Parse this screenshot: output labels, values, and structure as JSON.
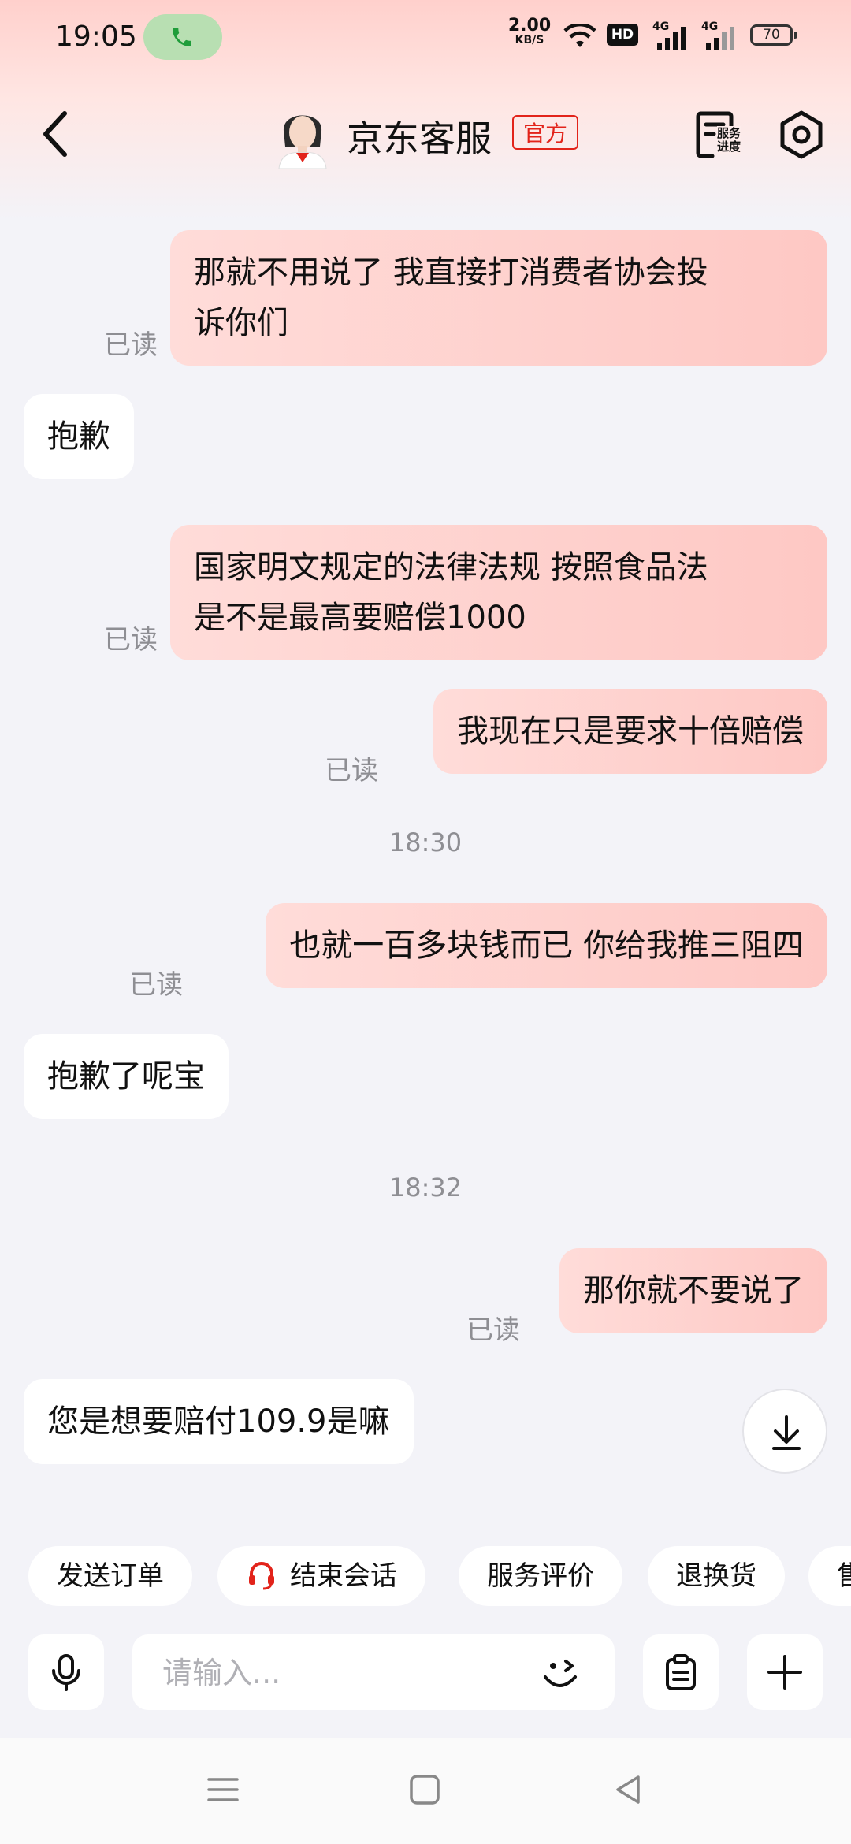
{
  "status_bar": {
    "time": "19:05",
    "net_speed_value": "2.00",
    "net_speed_unit": "KB/S",
    "hd_label": "HD",
    "signal_1": "4G",
    "signal_2": "4G",
    "battery": "70",
    "call_color": "#b8dfb2"
  },
  "header": {
    "title": "京东客服",
    "badge": "官方",
    "progress_label_line1": "服务",
    "progress_label_line2": "进度",
    "accent_color": "#e2231a"
  },
  "messages": [
    {
      "side": "out",
      "text_line1": "那就不用说了  我直接打消费者协会投",
      "text_line2": "诉你们",
      "status": "已读"
    },
    {
      "side": "in",
      "text": "抱歉"
    },
    {
      "side": "out",
      "text_line1": "国家明文规定的法律法规 按照食品法",
      "text_line2": "是不是最高要赔偿1000",
      "status": "已读"
    },
    {
      "side": "out",
      "text": "我现在只是要求十倍赔偿",
      "status": "已读"
    },
    {
      "side": "time",
      "text": "18:30"
    },
    {
      "side": "out",
      "text": "也就一百多块钱而已  你给我推三阻四",
      "status": "已读"
    },
    {
      "side": "in",
      "text": "抱歉了呢宝"
    },
    {
      "side": "time",
      "text": "18:32"
    },
    {
      "side": "out",
      "text": "那你就不要说了",
      "status": "已读"
    },
    {
      "side": "in",
      "text": "您是想要赔付109.9是嘛"
    }
  ],
  "quick_actions": [
    "发送订单",
    "结束会话",
    "服务评价",
    "退换货",
    "售"
  ],
  "input": {
    "placeholder": "请输入..."
  },
  "colors": {
    "bubble_out": "#fec8c4",
    "bubble_in": "#ffffff",
    "background": "#f3f3f8"
  }
}
